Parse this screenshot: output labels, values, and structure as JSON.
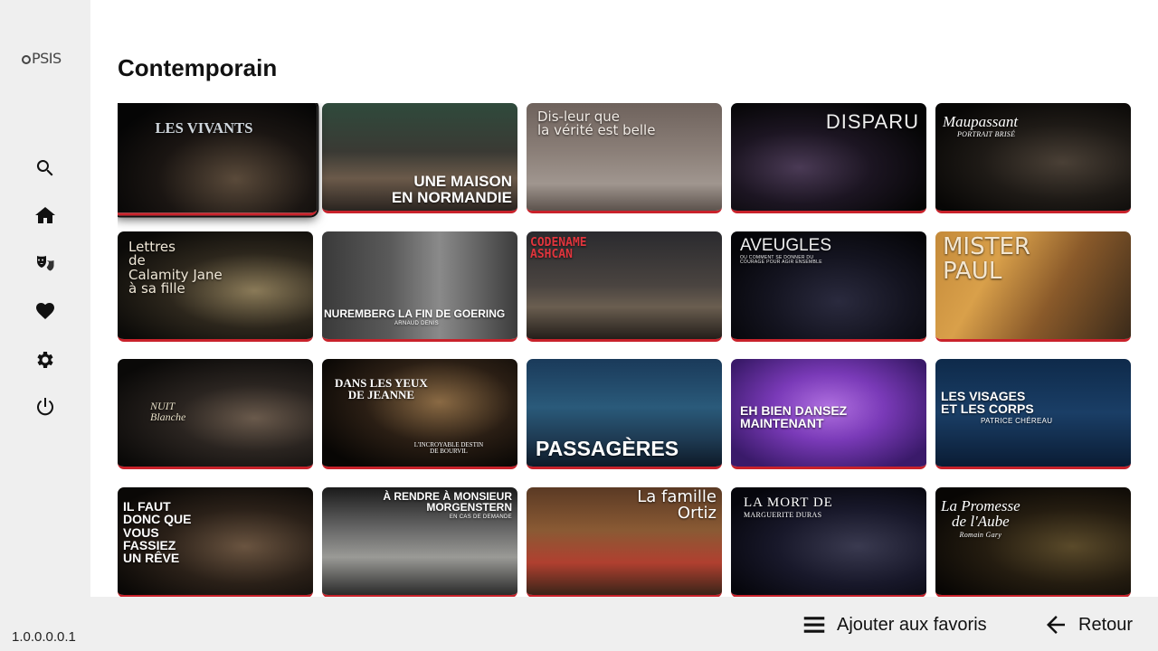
{
  "app": {
    "logo_text": "PSIS",
    "version": "1.0.0.0.0.1"
  },
  "sidebar": {
    "items": [
      {
        "name": "search",
        "icon": "search-icon"
      },
      {
        "name": "home",
        "icon": "home-icon"
      },
      {
        "name": "theatre",
        "icon": "theater-masks-icon"
      },
      {
        "name": "favorites",
        "icon": "heart-icon"
      },
      {
        "name": "settings",
        "icon": "gear-icon"
      },
      {
        "name": "power",
        "icon": "power-icon"
      }
    ]
  },
  "main": {
    "title": "Contemporain",
    "cards": [
      {
        "title": "LES VIVANTS",
        "subtitle": ""
      },
      {
        "title": "UNE MAISON\nEN NORMANDIE",
        "subtitle": ""
      },
      {
        "title": "Dis-leur que\nla vérité est belle",
        "subtitle": ""
      },
      {
        "title": "DISPARU",
        "subtitle": ""
      },
      {
        "title": "Maupassant",
        "subtitle": "PORTRAIT BRISÉ"
      },
      {
        "title": "Lettres\nde\nCalamity Jane\nà sa fille",
        "subtitle": ""
      },
      {
        "title": "NUREMBERG  LA FIN DE GOERING",
        "subtitle": "ARNAUD DENIS"
      },
      {
        "title": "CODENAME\nASHCAN",
        "subtitle": ""
      },
      {
        "title": "AVEUGLES",
        "subtitle": "OU COMMENT SE DONNER DU COURAGE POUR AGIR ENSEMBLE"
      },
      {
        "title": "MISTER\nPAUL",
        "subtitle": ""
      },
      {
        "title": "NUIT\nBlanche",
        "subtitle": ""
      },
      {
        "title": "DANS LES YEUX\nDE JEANNE",
        "subtitle": "L'INCROYABLE DESTIN DE BOURVIL"
      },
      {
        "title": "PASSAGÈRES",
        "subtitle": ""
      },
      {
        "title": "EH BIEN DANSEZ\nMAINTENANT",
        "subtitle": ""
      },
      {
        "title": "LES VISAGES\nET LES CORPS",
        "subtitle": "PATRICE CHÉREAU"
      },
      {
        "title": "IL FAUT\nDONC QUE\nVOUS\nFASSIEZ\nUN RÊVE",
        "subtitle": ""
      },
      {
        "title": "À RENDRE À MONSIEUR\nMORGENSTERN",
        "subtitle": "EN CAS DE DEMANDE"
      },
      {
        "title": "La famille\nOrtiz",
        "subtitle": ""
      },
      {
        "title": "LA MORT DE",
        "subtitle": "MARGUERITE DURAS"
      },
      {
        "title": "La Promesse\nde l'Aube",
        "subtitle": "Romain Gary"
      }
    ]
  },
  "bottombar": {
    "favorites_label": "Ajouter aux favoris",
    "back_label": "Retour"
  },
  "colors": {
    "accent": "#c9222b",
    "sidebar_bg": "#efefef"
  }
}
